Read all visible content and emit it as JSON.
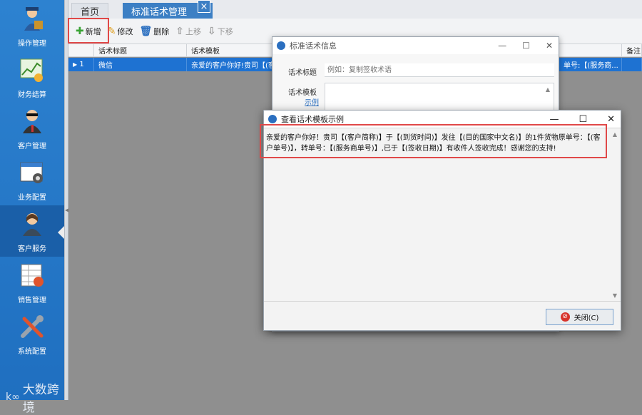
{
  "sidebar": {
    "items": [
      {
        "label": "操作管理",
        "icon": "operator-icon"
      },
      {
        "label": "财务结算",
        "icon": "finance-chart-icon"
      },
      {
        "label": "客户管理",
        "icon": "customer-manager-icon"
      },
      {
        "label": "业务配置",
        "icon": "business-config-icon"
      },
      {
        "label": "客户服务",
        "icon": "customer-service-icon",
        "active": true
      },
      {
        "label": "销售管理",
        "icon": "sales-spreadsheet-icon"
      },
      {
        "label": "系统配置",
        "icon": "tools-icon"
      }
    ],
    "watermark": "大数跨境"
  },
  "tabs": {
    "home": "首页",
    "current": "标准话术管理",
    "close_glyph": "×"
  },
  "toolbar": {
    "add": "新增",
    "edit": "修改",
    "delete": "删除",
    "move_up": "上移",
    "move_down": "下移"
  },
  "grid": {
    "headers": {
      "title": "话术标题",
      "template": "话术模板",
      "remark": "备注"
    },
    "row": {
      "index": "1",
      "title": "微信",
      "template": "亲爱的客户你好!贵司【(客",
      "tail": "单号:【(服务商..."
    }
  },
  "dialog_info": {
    "title": "标准话术信息",
    "title_label": "话术标题",
    "title_placeholder": "例如：复制签收术语",
    "template_label": "话术模板",
    "example_link": "示例"
  },
  "dialog_example": {
    "title": "查看话术模板示例",
    "text": "亲爱的客户你好！贵司【(客户简称)】于【(到货时间)】发往【(目的国家中文名)】的1件货物原单号：【(客户单号)】，转单号：【(服务商单号)】,已于【(签收日期)】有收件人签收完成！感谢您的支持!",
    "close_button": "关闭(C)"
  },
  "colors": {
    "sidebar": "#1f6fc0",
    "selected_row": "#1e72d2",
    "highlight": "#e04848",
    "active_tab": "#3c7fc4"
  }
}
